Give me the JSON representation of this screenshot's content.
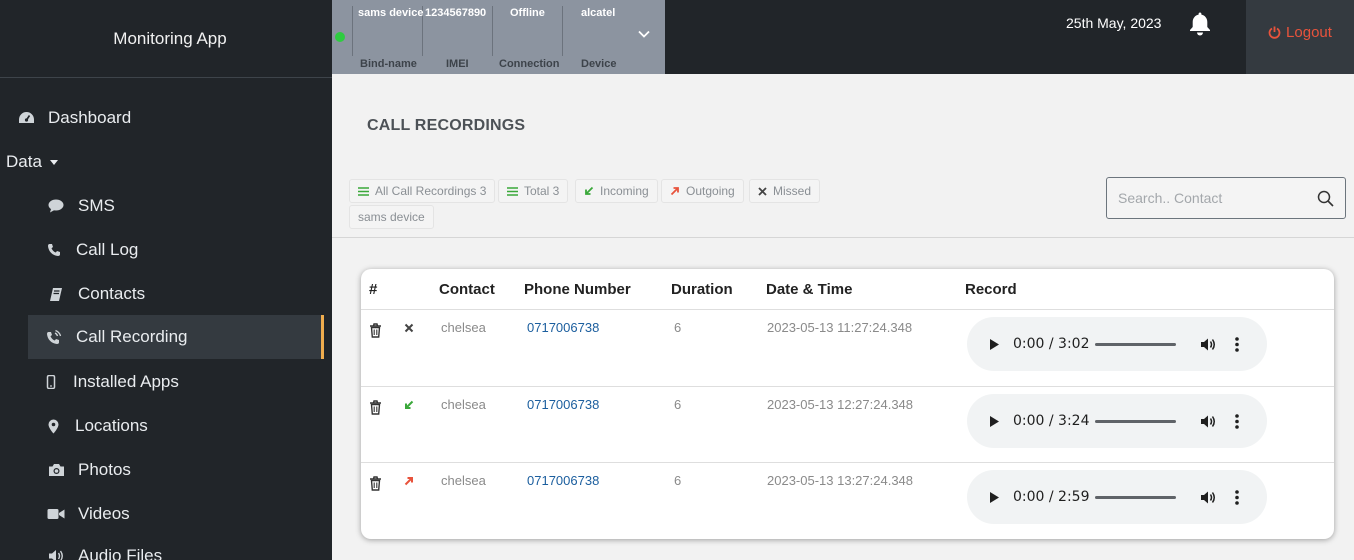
{
  "app": {
    "title": "Monitoring App"
  },
  "sidebar": {
    "items": [
      {
        "label": "Dashboard",
        "icon": "dashboard-icon"
      },
      {
        "label": "Data",
        "icon": "caret-down-icon"
      },
      {
        "label": "SMS",
        "icon": "comment-icon"
      },
      {
        "label": "Call Log",
        "icon": "phone-icon"
      },
      {
        "label": "Contacts",
        "icon": "address-book-icon"
      },
      {
        "label": "Call Recording",
        "icon": "phone-volume-icon",
        "active": true
      },
      {
        "label": "Installed Apps",
        "icon": "mobile-icon"
      },
      {
        "label": "Locations",
        "icon": "map-marker-icon"
      },
      {
        "label": "Photos",
        "icon": "camera-icon"
      },
      {
        "label": "Videos",
        "icon": "video-icon"
      },
      {
        "label": "Audio Files",
        "icon": "volume-icon"
      }
    ]
  },
  "device": {
    "status_color": "#2ecc40",
    "columns": [
      {
        "value": "sams device",
        "label": "Bind-name"
      },
      {
        "value": "1234567890",
        "label": "IMEI"
      },
      {
        "value": "Offline",
        "label": "Connection"
      },
      {
        "value": "alcatel",
        "label": "Device"
      }
    ]
  },
  "header": {
    "date": "25th May, 2023",
    "logout_label": "Logout"
  },
  "page": {
    "title": "CALL RECORDINGS",
    "filters": [
      {
        "label": "All Call Recordings 3",
        "icon": "list-icon"
      },
      {
        "label": "Total 3",
        "icon": "list-icon"
      },
      {
        "label": "Incoming",
        "icon": "incoming-arrow-icon"
      },
      {
        "label": "Outgoing",
        "icon": "outgoing-arrow-icon"
      },
      {
        "label": "Missed",
        "icon": "missed-x-icon"
      },
      {
        "label": "sams device",
        "icon": ""
      }
    ],
    "search": {
      "placeholder": "Search.. Contact"
    }
  },
  "table": {
    "headers": [
      "#",
      "Contact",
      "Phone Number",
      "Duration",
      "Date & Time",
      "Record"
    ],
    "rows": [
      {
        "type": "missed",
        "contact": "chelsea",
        "phone": "0717006738",
        "duration": "6",
        "datetime": "2023-05-13 11:27:24.348",
        "player_time": "0:00 / 3:02"
      },
      {
        "type": "incoming",
        "contact": "chelsea",
        "phone": "0717006738",
        "duration": "6",
        "datetime": "2023-05-13 12:27:24.348",
        "player_time": "0:00 / 3:24"
      },
      {
        "type": "outgoing",
        "contact": "chelsea",
        "phone": "0717006738",
        "duration": "6",
        "datetime": "2023-05-13 13:27:24.348",
        "player_time": "0:00 / 2:59"
      }
    ]
  },
  "colors": {
    "incoming": "#3aa83a",
    "outgoing": "#e8533c",
    "missed": "#444444",
    "accent": "#f0ad4e",
    "logout": "#e8533c"
  }
}
